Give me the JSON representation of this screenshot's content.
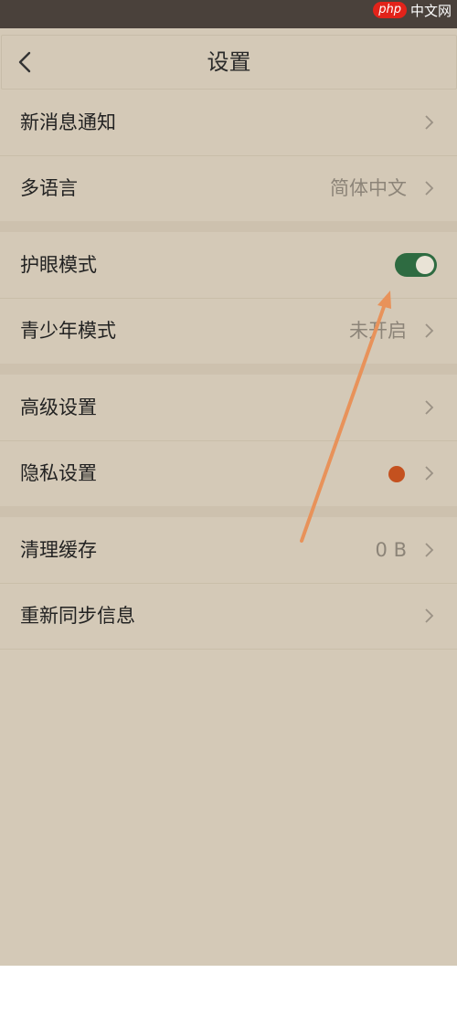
{
  "watermark": {
    "logo": "php",
    "text": "中文网"
  },
  "nav": {
    "title": "设置"
  },
  "groups": [
    {
      "items": [
        {
          "label": "新消息通知",
          "value": ""
        },
        {
          "label": "多语言",
          "value": "简体中文"
        }
      ]
    },
    {
      "items": [
        {
          "label": "护眼模式",
          "toggle_on": true
        },
        {
          "label": "青少年模式",
          "value": "未开启"
        }
      ]
    },
    {
      "items": [
        {
          "label": "高级设置",
          "value": ""
        },
        {
          "label": "隐私设置",
          "value": "",
          "badge": "red-dot"
        }
      ]
    },
    {
      "items": [
        {
          "label": "清理缓存",
          "value": "0 B"
        },
        {
          "label": "重新同步信息",
          "value": ""
        }
      ]
    }
  ],
  "colors": {
    "background": "#d4c9b7",
    "toggle_on": "#2e6b41",
    "badge": "#c4511f",
    "annotation_arrow": "#e8925a",
    "status_bar": "#4a413b"
  }
}
